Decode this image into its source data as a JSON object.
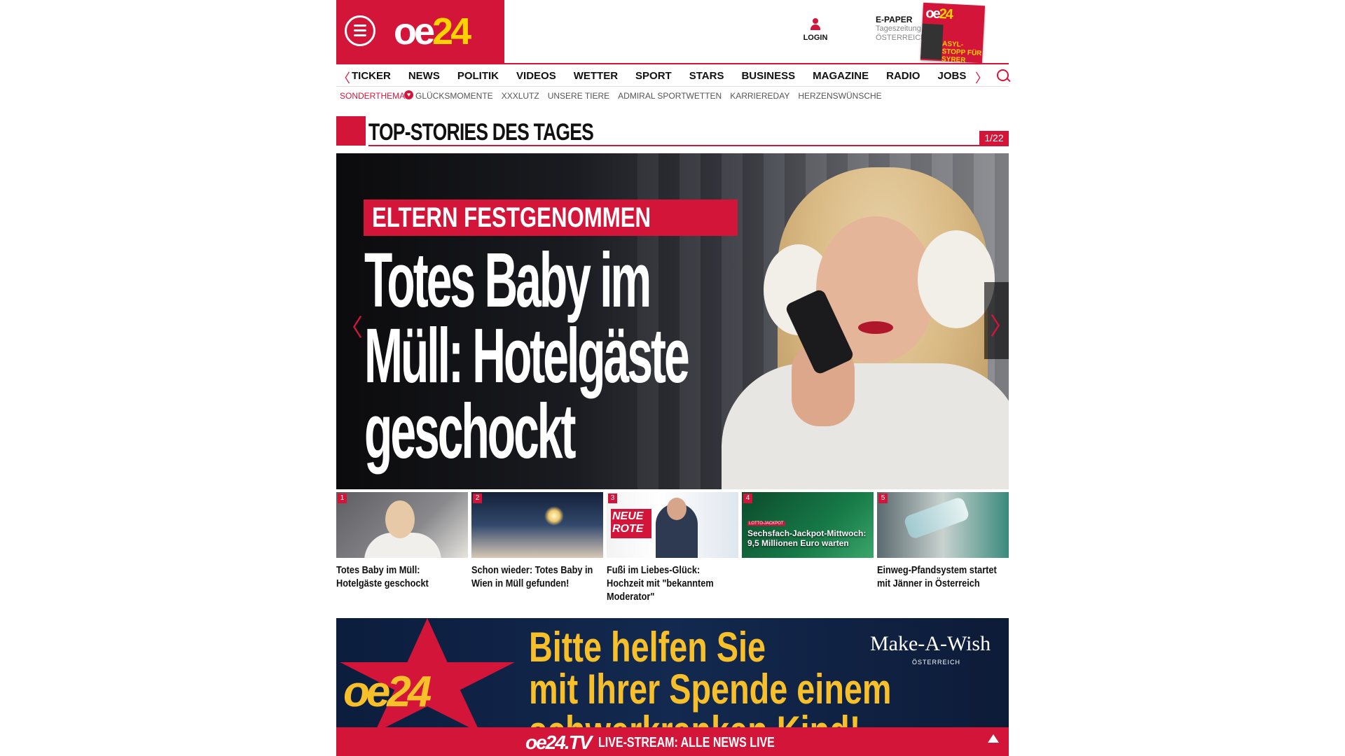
{
  "header": {
    "logo_main": "oe",
    "logo_accent": "24",
    "login_label": "LOGIN",
    "epaper_title": "E-PAPER",
    "epaper_line1": "Tageszeitung",
    "epaper_line2": "ÖSTERREICH",
    "cover_logo_main": "oe",
    "cover_logo_accent": "24",
    "cover_headline": "ASYL-STOPP FÜR SYRER"
  },
  "nav": {
    "items": [
      "TICKER",
      "NEWS",
      "POLITIK",
      "VIDEOS",
      "WETTER",
      "SPORT",
      "STARS",
      "BUSINESS",
      "MAGAZINE",
      "RADIO",
      "JOBS"
    ],
    "prev_glyph": "〈",
    "next_glyph": "〉"
  },
  "subnav": {
    "label": "SONDERTHEMA:",
    "items": [
      "GLÜCKSMOMENTE",
      "XXXLUTZ",
      "UNSERE TIERE",
      "ADMIRAL SPORTWETTEN",
      "KARRIEREDAY",
      "HERZENSWÜNSCHE"
    ]
  },
  "section": {
    "title": "TOP-STORIES DES TAGES",
    "counter": "1/22"
  },
  "hero": {
    "kicker": "ELTERN FESTGENOMMEN",
    "title": "Totes Baby im Müll: Hotelgäste geschockt",
    "prev_glyph": "〈",
    "next_glyph": "〉"
  },
  "thumbs": [
    {
      "num": "1",
      "title": "Totes Baby im Müll: Hotelgäste geschockt"
    },
    {
      "num": "2",
      "title": "Schon wieder: Totes Baby in Wien in Müll gefunden!"
    },
    {
      "num": "3",
      "title": "Fußi im Liebes-Glück: Hochzeit mit \"bekanntem Moderator\"",
      "badge": "NEUE ROTE"
    },
    {
      "num": "4",
      "title": "",
      "overlay_small": "LOTTO-JACKPOT",
      "overlay": "Sechsfach-Jackpot-Mittwoch: 9,5 Millionen Euro warten"
    },
    {
      "num": "5",
      "title": "Einweg-Pfandsystem startet mit Jänner in Österreich"
    }
  ],
  "banner": {
    "logo": "oe24",
    "text_line1": "Bitte helfen Sie",
    "text_line2": "mit Ihrer Spende einem",
    "text_line3": "schwerkranken Kind!",
    "partner": "Make-A-Wish",
    "partner_sub": "ÖSTERREICH"
  },
  "live": {
    "logo": "oe24.TV",
    "label": "LIVE-STREAM: ALLE NEWS LIVE"
  },
  "colors": {
    "brand_red": "#d4153a",
    "accent_yellow": "#ffd200"
  }
}
